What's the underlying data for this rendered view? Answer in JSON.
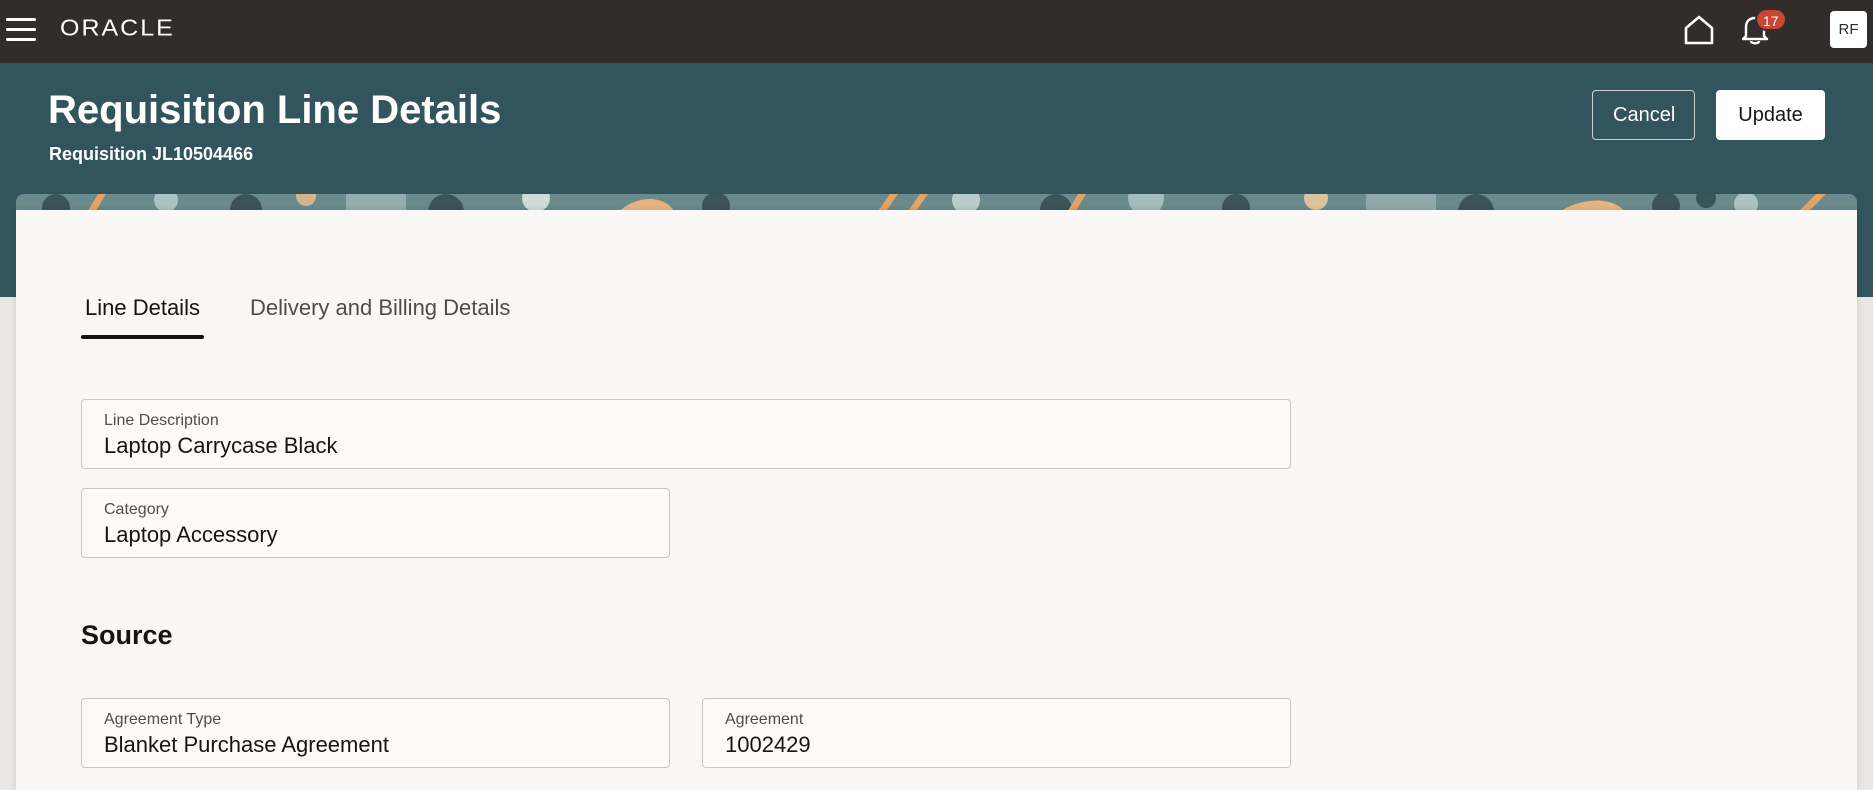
{
  "nav": {
    "logo": "ORACLE",
    "notifications_count": "17",
    "avatar_initials": "RF"
  },
  "header": {
    "title": "Requisition Line Details",
    "subtitle": "Requisition JL10504466",
    "cancel_label": "Cancel",
    "update_label": "Update"
  },
  "tabs": [
    {
      "label": "Line Details",
      "active": true
    },
    {
      "label": "Delivery and Billing Details",
      "active": false
    }
  ],
  "line_details": {
    "line_description": {
      "label": "Line Description",
      "value": "Laptop Carrycase Black"
    },
    "category": {
      "label": "Category",
      "value": "Laptop Accessory"
    }
  },
  "source": {
    "title": "Source",
    "agreement_type": {
      "label": "Agreement Type",
      "value": "Blanket Purchase Agreement"
    },
    "agreement": {
      "label": "Agreement",
      "value": "1002429"
    }
  },
  "colors": {
    "topbar": "#312d2a",
    "header_band": "#32545c",
    "badge": "#c74634",
    "card": "#f9f8f6"
  },
  "icons": {
    "menu": "hamburger-icon",
    "home": "home-icon",
    "notifications": "bell-icon"
  }
}
